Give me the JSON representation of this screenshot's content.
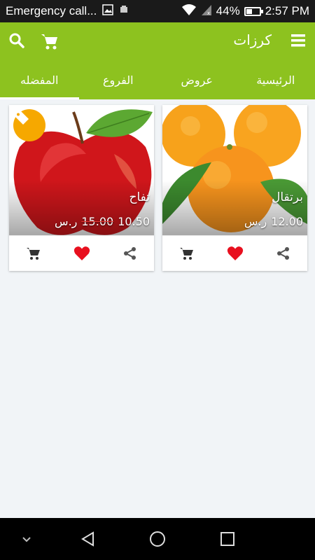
{
  "status_bar": {
    "notification": "Emergency call...",
    "battery": "44%",
    "battery_level": 0.44,
    "time": "2:57 PM"
  },
  "app_bar": {
    "title": "كرزات",
    "icons": [
      "search-icon",
      "cart-icon",
      "menu-icon"
    ]
  },
  "tabs": [
    {
      "label": "الرئيسية",
      "active": false
    },
    {
      "label": "عروض",
      "active": false
    },
    {
      "label": "الفروع",
      "active": false
    },
    {
      "label": "المفضله",
      "active": true
    }
  ],
  "products": [
    {
      "name": "برتقال",
      "price": "12.00",
      "currency": "ر.س",
      "old_price": ""
    },
    {
      "name": "تفاح",
      "price": "10.50",
      "currency": "ر.س",
      "old_price": "15.00"
    }
  ],
  "colors": {
    "primary": "#8dc21f",
    "sale_badge": "#f6a800",
    "heart": "#e8101f",
    "strike": "#e53935"
  },
  "nav": {
    "icons": [
      "collapse-icon",
      "back-icon",
      "home-icon",
      "recents-icon"
    ]
  }
}
